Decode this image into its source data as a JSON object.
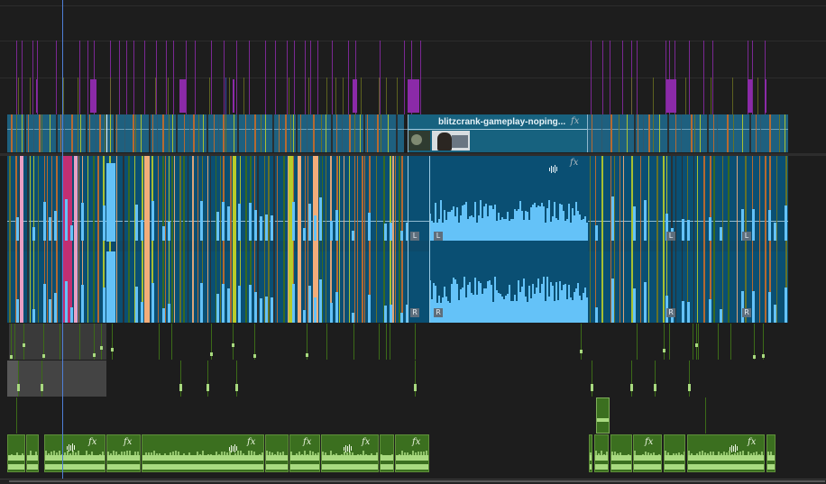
{
  "timeline": {
    "background": "#1d1d1d",
    "video_clip": {
      "title": "blitzcrank-gameplay-noping...",
      "fx_label": "fx",
      "color": "#1e607f",
      "selected_color": "#17627f"
    },
    "audio_clip": {
      "fx_label": "fx",
      "channel_left_label": "L",
      "channel_right_label": "R",
      "waveform_color": "#64c2f8",
      "body_color": "#0a4f73"
    },
    "music_clip": {
      "fx_label": "fx",
      "color": "#3b6f1f",
      "waveform_color": "#a9da80"
    },
    "marker_colors": {
      "purple": "#8b2aa8",
      "olive": "#6e7420",
      "orange": "#c76c29",
      "lime": "#b8cc2a",
      "peach": "#f2ad7a",
      "pink": "#e9a0c4",
      "magenta": "#c22e72",
      "green": "#3c6b18"
    },
    "playhead_color": "#4f7fd6"
  }
}
